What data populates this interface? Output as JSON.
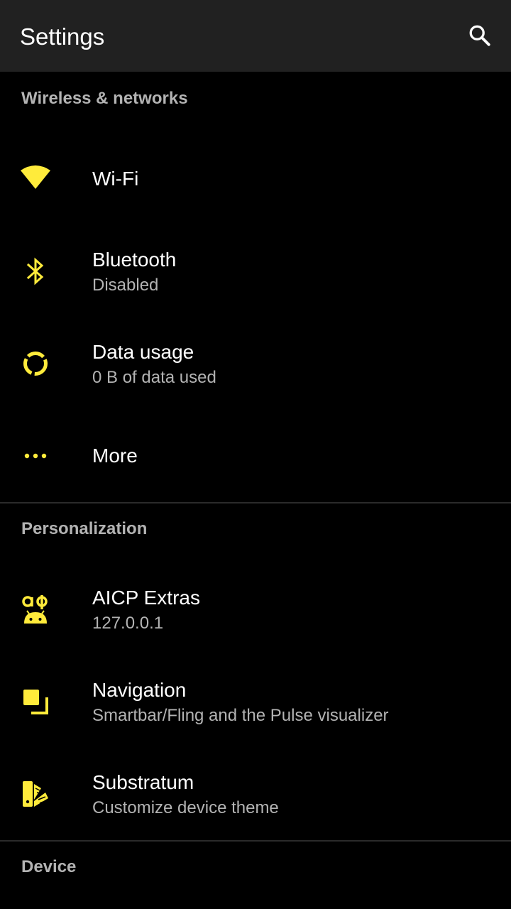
{
  "appbar": {
    "title": "Settings",
    "search_icon": "search-icon"
  },
  "colors": {
    "accent": "#FFEB3B",
    "appbar_bg": "#212121",
    "background": "#000000",
    "secondary_text": "#B3B3B3"
  },
  "sections": [
    {
      "header": "Wireless & networks",
      "items": [
        {
          "icon": "wifi-icon",
          "title": "Wi-Fi",
          "subtitle": ""
        },
        {
          "icon": "bluetooth-icon",
          "title": "Bluetooth",
          "subtitle": "Disabled"
        },
        {
          "icon": "data-usage-icon",
          "title": "Data usage",
          "subtitle": "0 B of data used"
        },
        {
          "icon": "more-icon",
          "title": "More",
          "subtitle": ""
        }
      ]
    },
    {
      "header": "Personalization",
      "items": [
        {
          "icon": "aicp-extras-icon",
          "title": "AICP Extras",
          "subtitle": "127.0.0.1"
        },
        {
          "icon": "navigation-icon",
          "title": "Navigation",
          "subtitle": "Smartbar/Fling and the Pulse visualizer"
        },
        {
          "icon": "substratum-icon",
          "title": "Substratum",
          "subtitle": "Customize device theme"
        }
      ]
    },
    {
      "header": "Device",
      "items": []
    }
  ]
}
